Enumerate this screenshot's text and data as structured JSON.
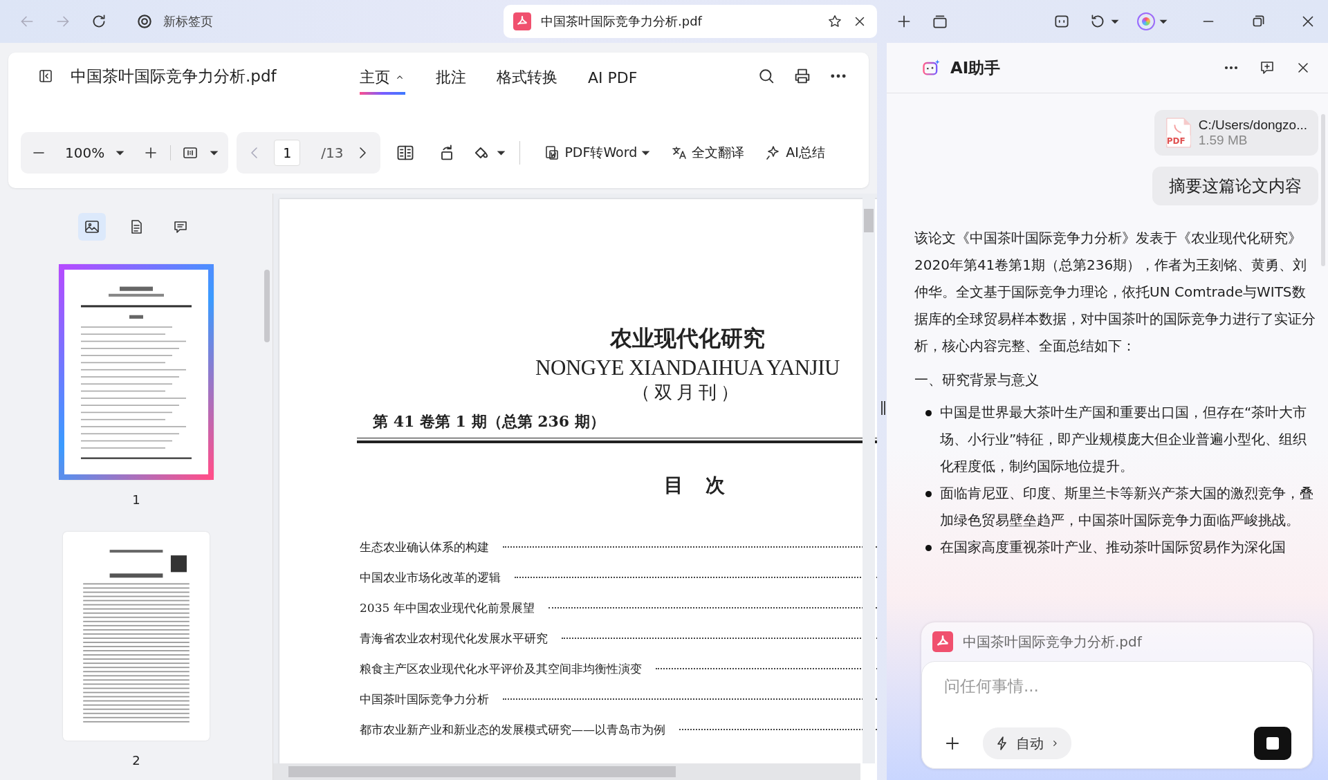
{
  "browser": {
    "tabs": [
      {
        "title": "新标签页",
        "selected": false
      },
      {
        "title": "中国茶叶国际竞争力分析.pdf",
        "selected": true
      }
    ]
  },
  "header": {
    "file_title": "中国茶叶国际竞争力分析.pdf",
    "menu_tabs": [
      {
        "label": "主页",
        "selected": true
      },
      {
        "label": "批注",
        "selected": false
      },
      {
        "label": "格式转换",
        "selected": false
      },
      {
        "label": "AI PDF",
        "selected": false
      }
    ]
  },
  "toolbar": {
    "zoom": "100%",
    "page": "1",
    "page_total": "/13",
    "actions": [
      {
        "kind": "word",
        "label": "PDF转Word"
      },
      {
        "kind": "translate",
        "label": "全文翻译"
      },
      {
        "kind": "summary",
        "label": "AI总结"
      }
    ]
  },
  "sidebar": {
    "tabs": [
      {
        "kind": "thumbnails",
        "selected": true
      },
      {
        "kind": "outline",
        "selected": false
      },
      {
        "kind": "comments",
        "selected": false
      }
    ],
    "thumbnails": [
      {
        "label": "1",
        "selected": true
      },
      {
        "label": "2",
        "selected": false
      }
    ]
  },
  "document": {
    "journal_title": "农业现代化研究",
    "journal_pinyin": "NONGYE XIANDAIHUA YANJIU",
    "frequency": "（双月刊）",
    "issue": "第 41 卷第 1 期（总第 236 期）",
    "toc_heading": "目 次",
    "toc": [
      "生态农业确认体系的构建",
      "中国农业市场化改革的逻辑",
      "2035 年中国农业现代化前景展望",
      "青海省农业农村现代化发展水平研究",
      "粮食主产区农业现代化水平评价及其空间非均衡性演变",
      "中国茶叶国际竞争力分析",
      "都市农业新产业和新业态的发展模式研究——以青岛市为例"
    ]
  },
  "assistant": {
    "title": "AI助手",
    "attachment": {
      "name": "C:/Users/dongzo...",
      "size": "1.59 MB",
      "file_type": "PDF"
    },
    "query": "摘要这篇论文内容",
    "answer_intro": "该论文《中国茶叶国际竞争力分析》发表于《农业现代化研究》2020年第41卷第1期（总第236期），作者为王刻铭、黄勇、刘仲华。全文基于国际竞争力理论，依托UN Comtrade与WITS数据库的全球贸易样本数据，对中国茶叶的国际竞争力进行了实证分析，核心内容完整、全面总结如下：",
    "section_heading": "一、研究背景与意义",
    "bullets": [
      "中国是世界最大茶叶生产国和重要出口国，但存在“茶叶大市场、小行业”特征，即产业规模庞大但企业普遍小型化、组织化程度低，制约国际地位提升。",
      "面临肯尼亚、印度、斯里兰卡等新兴产茶大国的激烈竞争，叠加绿色贸易壁垒趋严，中国茶叶国际竞争力面临严峻挑战。",
      "在国家高度重视茶叶产业、推动茶叶国际贸易作为深化国"
    ],
    "input": {
      "file": "中国茶叶国际竞争力分析.pdf",
      "placeholder": "问任何事情...",
      "mode": "自动"
    }
  }
}
